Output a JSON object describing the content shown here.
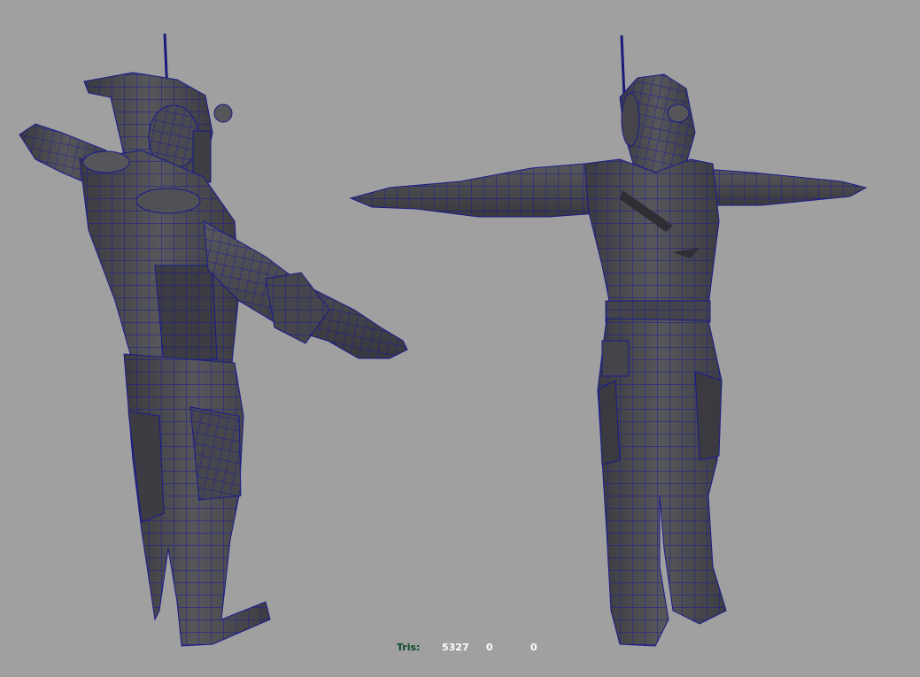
{
  "viewport": {
    "background": "#a0a0a0",
    "mesh_fill": "#4a4a4e",
    "mesh_shade": "#3a3a3e",
    "mesh_highlight": "#5a5a5e",
    "wire_color": "#1a1a9a"
  },
  "hud": {
    "tris_label": "Tris:",
    "tris_label_color": "#0c4a2a",
    "values_color": "#ffffff",
    "tris_count": "5327",
    "selected_count": "0",
    "faces_count": "0"
  },
  "models": [
    {
      "name": "robot-character-perspective-view",
      "label": ""
    },
    {
      "name": "robot-character-front-view",
      "label": ""
    }
  ]
}
